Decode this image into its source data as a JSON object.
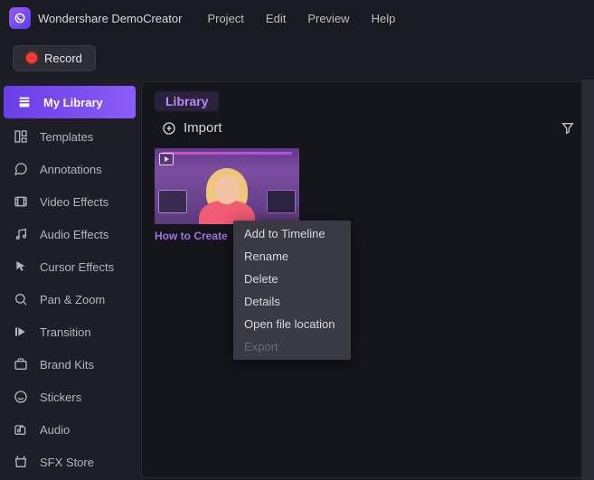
{
  "app": {
    "title": "Wondershare DemoCreator"
  },
  "menubar": [
    "Project",
    "Edit",
    "Preview",
    "Help"
  ],
  "toolbar": {
    "record": "Record"
  },
  "sidebar": {
    "items": [
      {
        "label": "My Library",
        "icon": "library"
      },
      {
        "label": "Templates",
        "icon": "templates"
      },
      {
        "label": "Annotations",
        "icon": "annotations"
      },
      {
        "label": "Video Effects",
        "icon": "video-fx"
      },
      {
        "label": "Audio Effects",
        "icon": "audio-fx"
      },
      {
        "label": "Cursor Effects",
        "icon": "cursor-fx"
      },
      {
        "label": "Pan & Zoom",
        "icon": "pan-zoom"
      },
      {
        "label": "Transition",
        "icon": "transition"
      },
      {
        "label": "Brand Kits",
        "icon": "brand-kits"
      },
      {
        "label": "Stickers",
        "icon": "stickers"
      },
      {
        "label": "Audio",
        "icon": "audio"
      },
      {
        "label": "SFX Store",
        "icon": "sfx-store"
      }
    ]
  },
  "main": {
    "tab": "Library",
    "import": "Import",
    "clip": {
      "title": "How to Create"
    }
  },
  "context_menu": {
    "items": [
      {
        "label": "Add to Timeline",
        "enabled": true
      },
      {
        "label": "Rename",
        "enabled": true
      },
      {
        "label": "Delete",
        "enabled": true
      },
      {
        "label": "Details",
        "enabled": true
      },
      {
        "label": "Open file location",
        "enabled": true
      },
      {
        "label": "Export",
        "enabled": false
      }
    ]
  }
}
